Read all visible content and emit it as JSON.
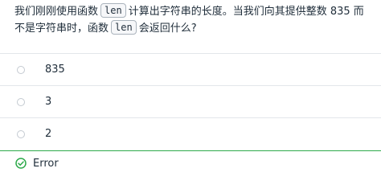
{
  "question": {
    "part1": "我们刚刚使用函数",
    "code1": "len",
    "part2": "计算出字符串的长度。当我们向其提供整数 835 而不是字符串时，函数",
    "code2": "len",
    "part3": "会返回什么?"
  },
  "options": [
    {
      "label": "835",
      "state": "unselected"
    },
    {
      "label": "3",
      "state": "unselected"
    },
    {
      "label": "2",
      "state": "unselected"
    },
    {
      "label": "Error",
      "state": "correct"
    }
  ],
  "colors": {
    "correct": "#2eaa4b",
    "divider": "#e3e6ea",
    "radio": "#c4cad1"
  }
}
